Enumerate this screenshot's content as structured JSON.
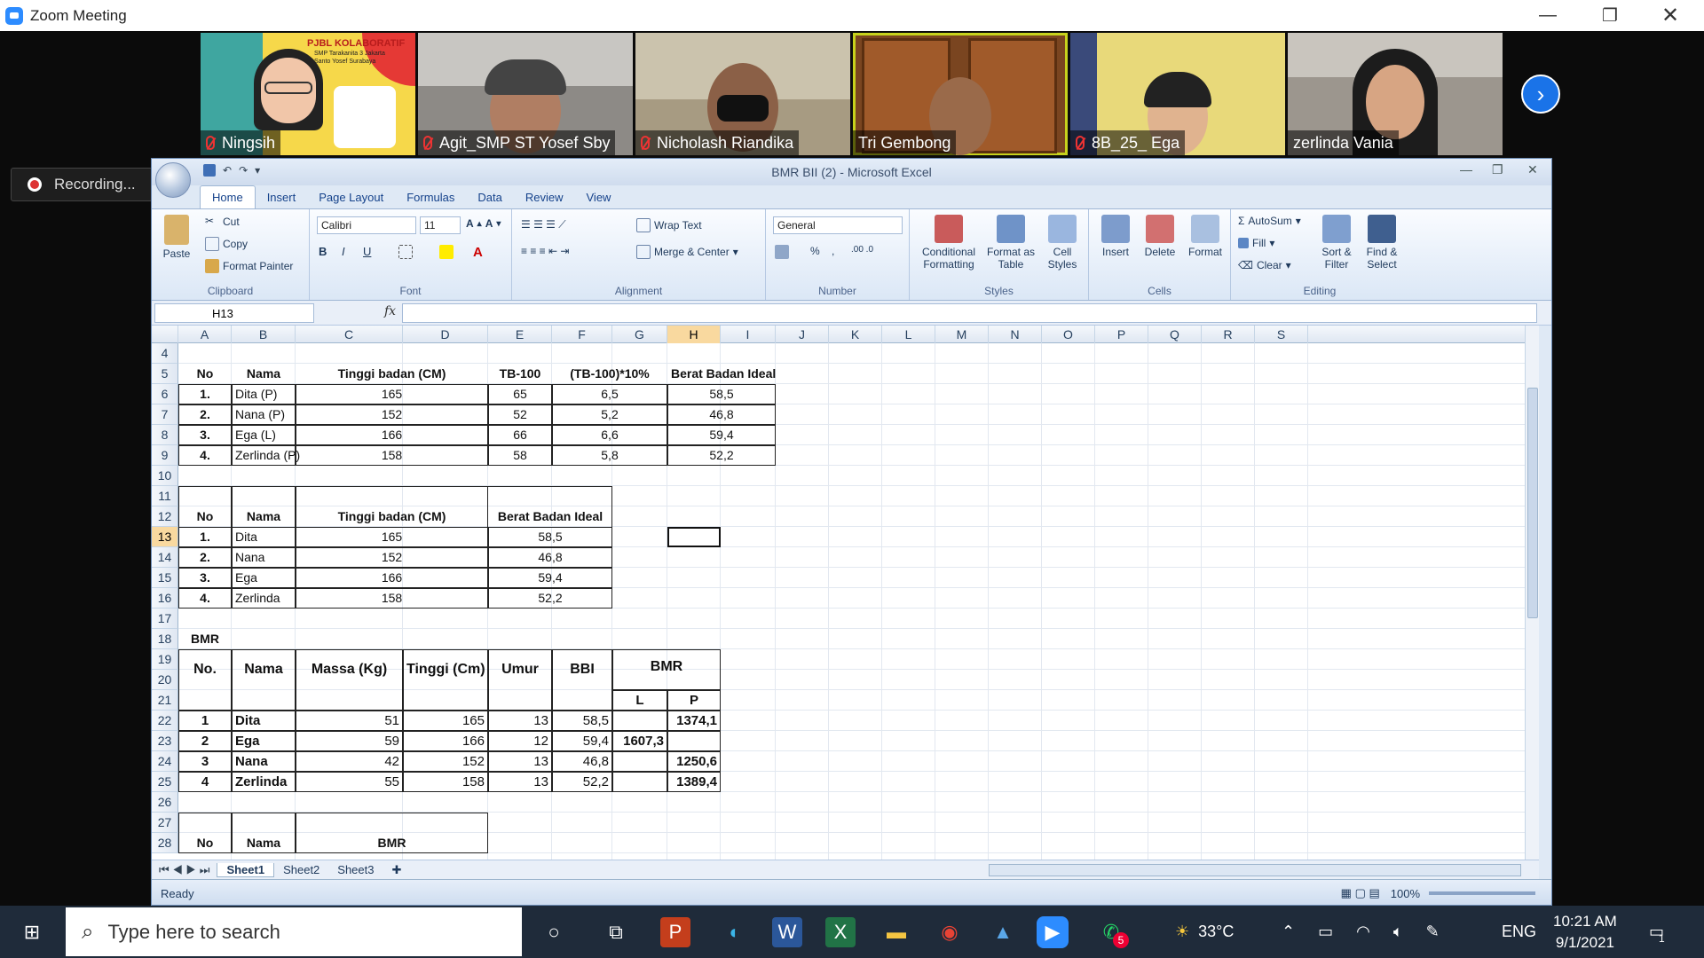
{
  "zoom": {
    "title": "Zoom Meeting",
    "recording": "Recording...",
    "participants": [
      {
        "name": "Ningsih",
        "muted": true,
        "slide_title": "PJBL KOLABORATIF",
        "slide_sub": "SMP Tarakanita 3 Jakarta",
        "slide_sub2": "Santo Yosef Surabaya"
      },
      {
        "name": "Agit_SMP ST Yosef Sby",
        "muted": true
      },
      {
        "name": "Nicholash Riandika",
        "muted": true
      },
      {
        "name": "Tri Gembong",
        "muted": false
      },
      {
        "name": "8B_25_ Ega",
        "muted": true
      },
      {
        "name": "zerlinda Vania",
        "muted": false
      }
    ]
  },
  "excel": {
    "title": "BMR BII (2) - Microsoft Excel",
    "tabs": [
      "Home",
      "Insert",
      "Page Layout",
      "Formulas",
      "Data",
      "Review",
      "View"
    ],
    "ribbon": {
      "clipboard": {
        "paste": "Paste",
        "cut": "Cut",
        "copy": "Copy",
        "format_painter": "Format Painter",
        "label": "Clipboard"
      },
      "font": {
        "name": "Calibri",
        "size": "11",
        "label": "Font",
        "bold": "B",
        "italic": "I",
        "underline": "U"
      },
      "alignment": {
        "wrap": "Wrap Text",
        "merge": "Merge & Center",
        "label": "Alignment"
      },
      "number": {
        "format": "General",
        "label": "Number",
        "percent": "%",
        "comma": ","
      },
      "styles": {
        "conditional": "Conditional Formatting",
        "table": "Format as Table",
        "cell": "Cell Styles",
        "label": "Styles"
      },
      "cells": {
        "insert": "Insert",
        "delete": "Delete",
        "format": "Format",
        "label": "Cells"
      },
      "editing": {
        "autosum": "AutoSum",
        "fill": "Fill",
        "clear": "Clear",
        "sort": "Sort & Filter",
        "find": "Find & Select",
        "label": "Editing"
      }
    },
    "namebox": "H13",
    "fx": "fx",
    "columns": [
      "A",
      "B",
      "C",
      "D",
      "E",
      "F",
      "G",
      "H",
      "I",
      "J",
      "K",
      "L",
      "M",
      "N",
      "O",
      "P",
      "Q",
      "R",
      "S"
    ],
    "rows": [
      "4",
      "5",
      "6",
      "7",
      "8",
      "9",
      "10",
      "11",
      "12",
      "13",
      "14",
      "15",
      "16",
      "17",
      "18",
      "19",
      "20",
      "21",
      "22",
      "23",
      "24",
      "25",
      "26",
      "27",
      "28"
    ],
    "table1": {
      "headers": [
        "No",
        "Nama",
        "Tinggi badan (CM)",
        "TB-100",
        "(TB-100)*10%",
        "Berat Badan Ideal"
      ],
      "rows": [
        [
          "1.",
          "Dita (P)",
          "165",
          "65",
          "6,5",
          "58,5"
        ],
        [
          "2.",
          "Nana (P)",
          "152",
          "52",
          "5,2",
          "46,8"
        ],
        [
          "3.",
          "Ega (L)",
          "166",
          "66",
          "6,6",
          "59,4"
        ],
        [
          "4.",
          "Zerlinda (P)",
          "158",
          "58",
          "5,8",
          "52,2"
        ]
      ]
    },
    "table2": {
      "headers": [
        "No",
        "Nama",
        "Tinggi badan (CM)",
        "Berat Badan Ideal"
      ],
      "rows": [
        [
          "1.",
          "Dita",
          "165",
          "58,5"
        ],
        [
          "2.",
          "Nana",
          "152",
          "46,8"
        ],
        [
          "3.",
          "Ega",
          "166",
          "59,4"
        ],
        [
          "4.",
          "Zerlinda",
          "158",
          "52,2"
        ]
      ]
    },
    "table3": {
      "caption": "BMR",
      "headers": [
        "No.",
        "Nama",
        "Massa (Kg)",
        "Tinggi (Cm)",
        "Umur",
        "BBI",
        "BMR"
      ],
      "sub": [
        "L",
        "P"
      ],
      "rows": [
        [
          "1",
          "Dita",
          "51",
          "165",
          "13",
          "58,5",
          "",
          "1374,1"
        ],
        [
          "2",
          "Ega",
          "59",
          "166",
          "12",
          "59,4",
          "1607,3",
          ""
        ],
        [
          "3",
          "Nana",
          "42",
          "152",
          "13",
          "46,8",
          "",
          "1250,6"
        ],
        [
          "4",
          "Zerlinda",
          "55",
          "158",
          "13",
          "52,2",
          "",
          "1389,4"
        ]
      ]
    },
    "table4": {
      "headers": [
        "No",
        "Nama",
        "BMR"
      ]
    },
    "sheets": [
      "Sheet1",
      "Sheet2",
      "Sheet3"
    ],
    "status": "Ready",
    "zoom": "100%"
  },
  "taskbar": {
    "search_placeholder": "Type here to search",
    "weather": "33°C",
    "lang": "ENG",
    "time": "10:21 AM",
    "date": "9/1/2021",
    "whatsapp_badge": "5",
    "notif_badge": "1"
  }
}
